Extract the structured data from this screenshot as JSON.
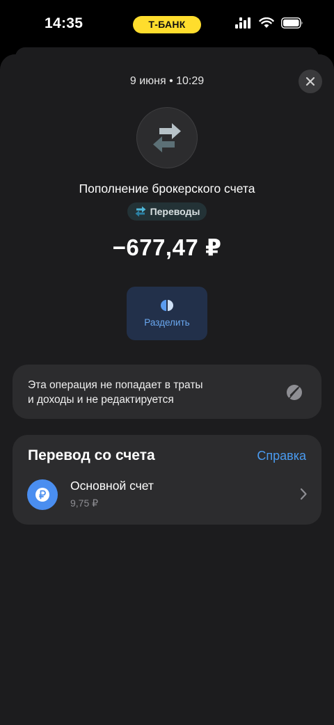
{
  "status_bar": {
    "time": "14:35",
    "bank_badge": "Т-БАНК",
    "icons": [
      "signal-icon",
      "wifi-icon",
      "battery-icon"
    ]
  },
  "operation": {
    "datetime": "9 июня • 10:29",
    "title": "Пополнение брокерского счета",
    "category": "Переводы",
    "amount": "−677,47 ₽",
    "icon": "transfer-arrows-icon"
  },
  "actions": {
    "split_label": "Разделить"
  },
  "notice": {
    "line1": "Эта операция не попадает в траты",
    "line2": "и доходы и не редактируется"
  },
  "transfer": {
    "title": "Перевод со счета",
    "help_label": "Справка",
    "account": {
      "name": "Основной счет",
      "balance": "9,75 ₽"
    }
  },
  "colors": {
    "accent_yellow": "#ffdd2d",
    "link_blue": "#4a9bf0",
    "sheet_bg": "#1c1c1e",
    "card_bg": "#2c2c2e"
  }
}
